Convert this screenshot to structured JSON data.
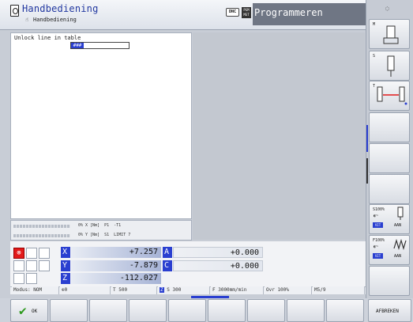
{
  "header": {
    "mode_title": "Handbediening",
    "mode_subtitle": "Handbediening",
    "dnc_label": "DNC",
    "prog_icon_label": "PGM MGT",
    "program_title": "Programmeren"
  },
  "table": {
    "title": "Unlock line in table",
    "input_value": "###"
  },
  "status_lines": {
    "line1": "0% X [Nm]  P1  -T1",
    "line2": "0% Y [Nm]  S1  LIMIT 7"
  },
  "axes": [
    {
      "letter": "X",
      "value": "+7.257"
    },
    {
      "letter": "Y",
      "value": "-7.879"
    },
    {
      "letter": "Z",
      "value": "-112.027"
    }
  ],
  "rot_axes": [
    {
      "letter": "A",
      "value": "+0.000"
    },
    {
      "letter": "C",
      "value": "+0.000"
    }
  ],
  "status_bar": {
    "modus": "Modus: NOM",
    "t0": "0",
    "tool": "T 500",
    "spindle_label": "Z",
    "spindle": "S 300",
    "feed": "F 3000mm/min",
    "ovr": "Ovr 100%",
    "m": "M5/9"
  },
  "right_softkeys": {
    "m_label": "M",
    "s_label": "S",
    "t_label": "T",
    "s100": "S100%",
    "f100": "F100%",
    "vit": "VIT",
    "aan": "AAN"
  },
  "softkeys": {
    "ok": "OK",
    "afbreken": "AFBREKEN"
  },
  "colors": {
    "accent_blue": "#2a3fd0",
    "alarm_red": "#e21a1a",
    "ok_green": "#2f9a1f"
  }
}
